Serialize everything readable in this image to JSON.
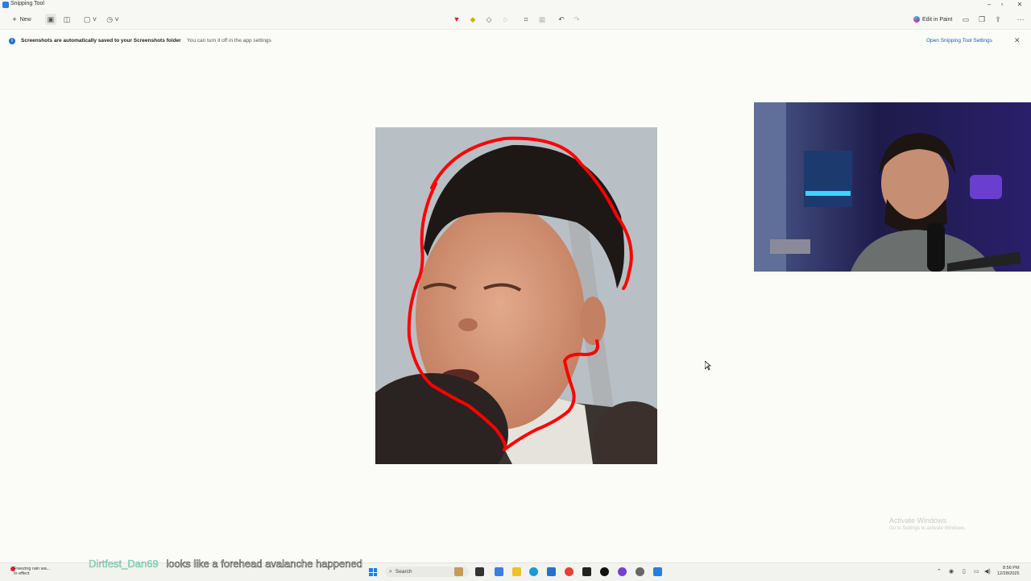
{
  "window": {
    "title": "Snipping Tool"
  },
  "toolbar": {
    "new_label": "New",
    "edit_in_paint_label": "Edit in Paint"
  },
  "infobar": {
    "bold_text": "Screenshots are automatically saved to your Screenshots folder",
    "text": "You can turn it off in the app settings",
    "link": "Open Snipping Tool Settings"
  },
  "watermark": {
    "title": "Activate Windows",
    "subtitle": "Go to Settings to activate Windows."
  },
  "chat": {
    "username": "Dirtfest_Dan69",
    "message": "looks like a forehead avalanche happened"
  },
  "taskbar": {
    "notice_line1": "Freezing rain wa...",
    "notice_line2": "In effect",
    "search_placeholder": "Search",
    "time": "8:56 PM",
    "date": "12/28/2025"
  },
  "icons": [
    "snipping-tool-icon",
    "new-icon",
    "screenshot-mode-icon",
    "video-mode-icon",
    "rectangle-mode-icon",
    "timer-icon",
    "ballpoint-pen-icon",
    "highlighter-icon",
    "eraser-icon",
    "lasso-icon",
    "crop-icon",
    "text-actions-icon",
    "undo-icon",
    "redo-icon",
    "paint-icon",
    "save-icon",
    "copy-icon",
    "share-icon",
    "more-icon",
    "info-icon",
    "close-icon",
    "cursor-icon",
    "windows-start-icon",
    "search-icon"
  ],
  "colors": {
    "pen_stroke": "#ff0000",
    "info_accent": "#1a6fd6",
    "chat_username": "#9ee0c9"
  }
}
